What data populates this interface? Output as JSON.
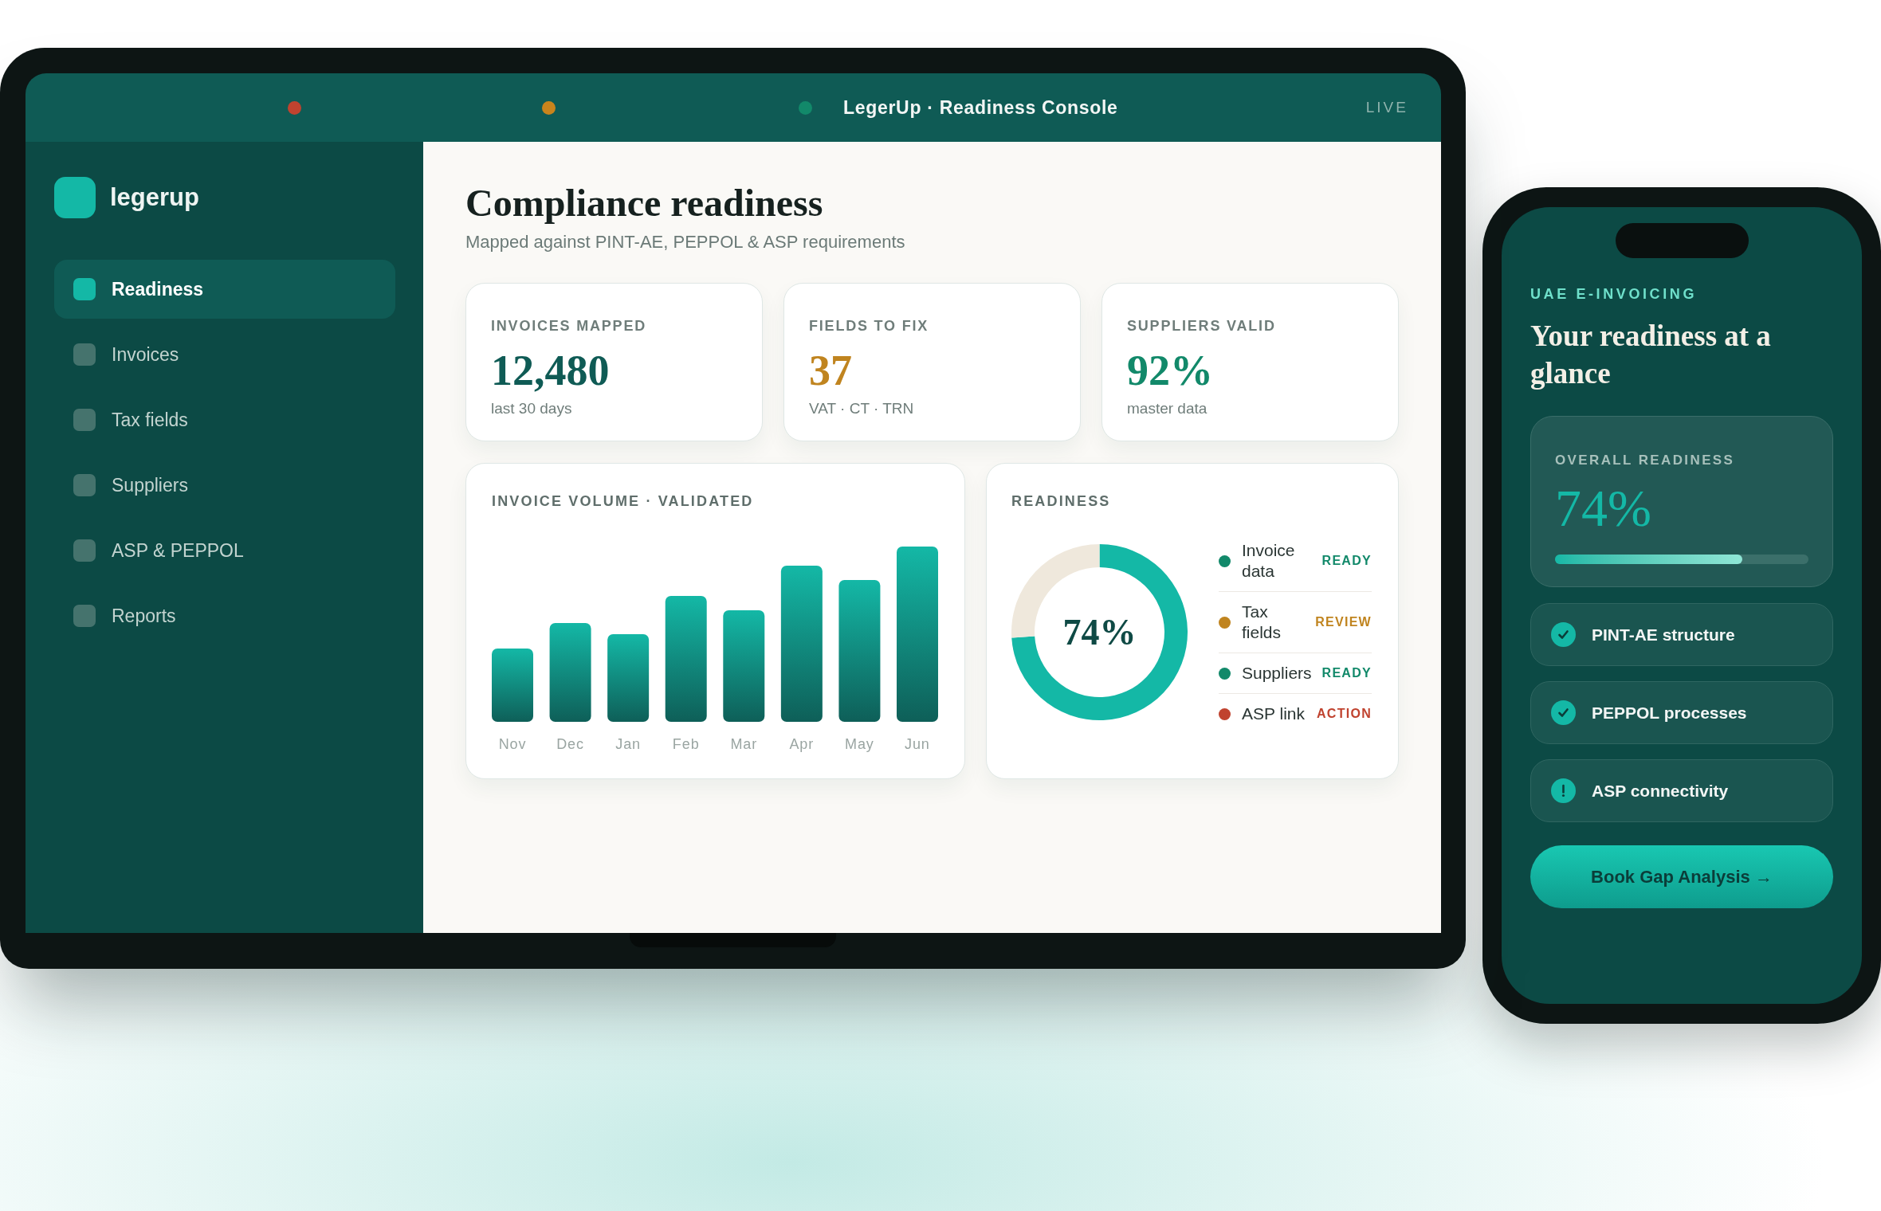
{
  "window": {
    "title": "LegerUp · Readiness Console",
    "badge": "LIVE"
  },
  "sidebar": {
    "brand": "legerup",
    "items": [
      {
        "label": "Readiness",
        "selected": true
      },
      {
        "label": "Invoices",
        "selected": false
      },
      {
        "label": "Tax fields",
        "selected": false
      },
      {
        "label": "Suppliers",
        "selected": false
      },
      {
        "label": "ASP & PEPPOL",
        "selected": false
      },
      {
        "label": "Reports",
        "selected": false
      }
    ]
  },
  "header": {
    "title": "Compliance readiness",
    "subtitle": "Mapped against PINT-AE, PEPPOL & ASP requirements"
  },
  "stats": [
    {
      "label": "INVOICES MAPPED",
      "value": "12,480",
      "note": "last 30 days",
      "color": "#0f5b55"
    },
    {
      "label": "FIELDS TO FIX",
      "value": "37",
      "note": "VAT · CT · TRN",
      "color": "#c0841f"
    },
    {
      "label": "SUPPLIERS VALID",
      "value": "92%",
      "note": "master data",
      "color": "#12896a"
    }
  ],
  "volume_chart": {
    "title": "INVOICE VOLUME · VALIDATED",
    "months": [
      "Nov",
      "Dec",
      "Jan",
      "Feb",
      "Mar",
      "Apr",
      "May",
      "Jun"
    ]
  },
  "readiness": {
    "title": "READINESS",
    "chart_data": {
      "type": "donut",
      "values": [
        74,
        26
      ]
    },
    "center_label": "74%",
    "items": [
      {
        "label": "Invoice data",
        "status": "READY",
        "color": "#12896a"
      },
      {
        "label": "Tax fields",
        "status": "REVIEW",
        "color": "#c0841f"
      },
      {
        "label": "Suppliers",
        "status": "READY",
        "color": "#12896a"
      },
      {
        "label": "ASP link",
        "status": "ACTION",
        "color": "#c0432f"
      }
    ]
  },
  "phone": {
    "eyebrow": "UAE E-INVOICING",
    "heading": "Your readiness at a glance",
    "overall": {
      "label": "OVERALL READINESS",
      "reading": "74%",
      "level": 0.74
    },
    "checks": [
      {
        "label": "PINT-AE structure",
        "kind": "done"
      },
      {
        "label": "PEPPOL processes",
        "kind": "done"
      },
      {
        "label": "ASP connectivity",
        "kind": "warning"
      }
    ],
    "cta": "Book Gap Analysis →"
  }
}
